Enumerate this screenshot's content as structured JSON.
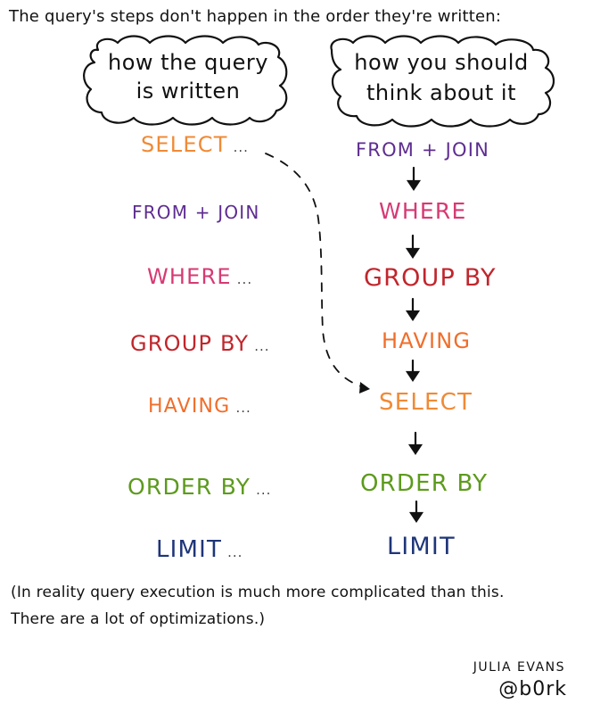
{
  "heading": "The query's steps don't happen in the order they're written:",
  "clouds": {
    "left": {
      "line1": "how the query",
      "line2": "is written"
    },
    "right": {
      "line1": "how you should",
      "line2": "think about it"
    }
  },
  "left_column": [
    {
      "label": "SELECT",
      "dots": "...",
      "color": "#f08a35"
    },
    {
      "label": "FROM + JOIN",
      "dots": "",
      "color": "#5e2d91"
    },
    {
      "label": "WHERE",
      "dots": "...",
      "color": "#d63a74"
    },
    {
      "label": "GROUP BY",
      "dots": "...",
      "color": "#c0262c"
    },
    {
      "label": "HAVING",
      "dots": "...",
      "color": "#f06e2a"
    },
    {
      "label": "ORDER BY",
      "dots": "...",
      "color": "#5d9a1d"
    },
    {
      "label": "LIMIT",
      "dots": "...",
      "color": "#1e3578"
    }
  ],
  "right_column": [
    {
      "label": "FROM + JOIN",
      "color": "#5e2d91"
    },
    {
      "label": "WHERE",
      "color": "#d63a74"
    },
    {
      "label": "GROUP BY",
      "color": "#c0262c"
    },
    {
      "label": "HAVING",
      "color": "#f06e2a"
    },
    {
      "label": "SELECT",
      "color": "#f08a35"
    },
    {
      "label": "ORDER BY",
      "color": "#5d9a1d"
    },
    {
      "label": "LIMIT",
      "color": "#1e3578"
    }
  ],
  "footer": {
    "line1": "(In reality query execution is much more complicated than this.",
    "line2": "There are a lot of optimizations.)"
  },
  "author": {
    "name": "JULIA EVANS",
    "handle": "@b0rk"
  }
}
